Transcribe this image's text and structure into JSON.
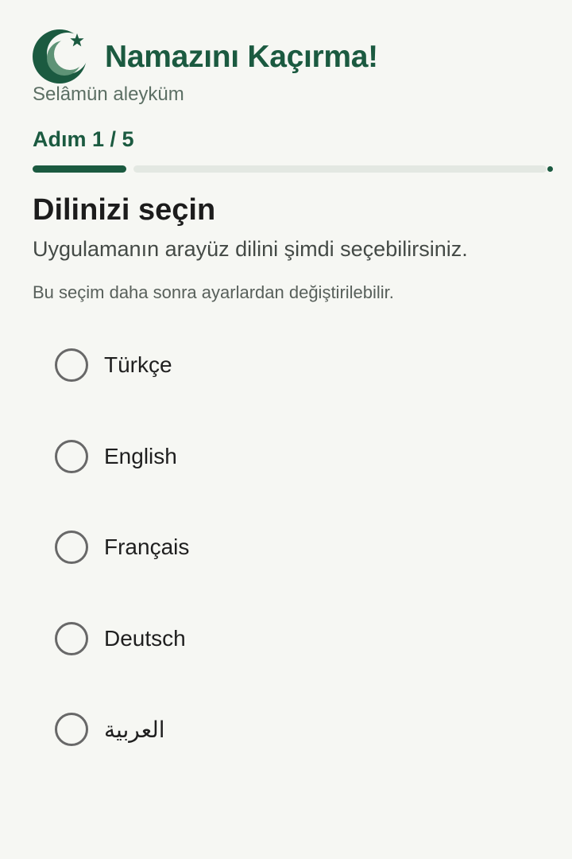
{
  "app": {
    "title": "Namazını Kaçırma!",
    "greeting": "Selâmün aleyküm",
    "logo_icon": "crescent-star-icon",
    "brand_color": "#1b5a40"
  },
  "progress": {
    "label": "Adım 1 / 5",
    "current": 1,
    "total": 5
  },
  "section": {
    "title": "Dilinizi seçin",
    "description": "Uygulamanın arayüz dilini şimdi seçebilirsiniz.",
    "note": "Bu seçim daha sonra ayarlardan değiştirilebilir."
  },
  "languages": [
    {
      "label": "Türkçe",
      "selected": false
    },
    {
      "label": "English",
      "selected": false
    },
    {
      "label": "Français",
      "selected": false
    },
    {
      "label": "Deutsch",
      "selected": false
    },
    {
      "label": "العربية",
      "selected": false
    }
  ]
}
